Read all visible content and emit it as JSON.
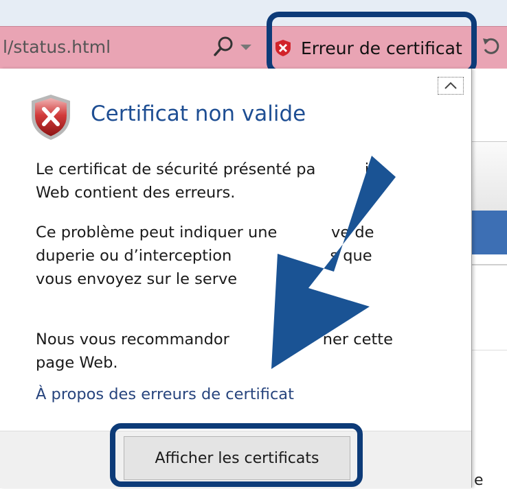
{
  "browser": {
    "url_fragment": "l/status.html",
    "search_icon": "search-icon",
    "dropdown_icon": "chevron-down-icon",
    "certificate_error_button": "Erreur de certificat",
    "certificate_error_icon": "error-x-icon",
    "refresh_icon": "refresh-icon"
  },
  "popup": {
    "title": "Certificat non valide",
    "shield_icon": "shield-error-icon",
    "paragraph1": "Le certificat de sécurité présenté pa          ite\nWeb contient des erreurs.",
    "paragraph2": "Ce problème peut indiquer une           ve de\nduperie ou d’interception                    s que\nvous envoyez sur le serve",
    "paragraph3": "Nous vous recommandor                   ner cette\npage Web.",
    "link": "À propos des erreurs de certificat",
    "view_button": "Afficher les certificats",
    "close_icon": "close-icon"
  },
  "right_pane": {
    "partial_text": "e"
  },
  "colors": {
    "address_bar_error": "#e9a4b4",
    "highlight_border": "#0d3b78",
    "arrow": "#1a5394",
    "title": "#1e4e93",
    "link": "#27447d"
  }
}
